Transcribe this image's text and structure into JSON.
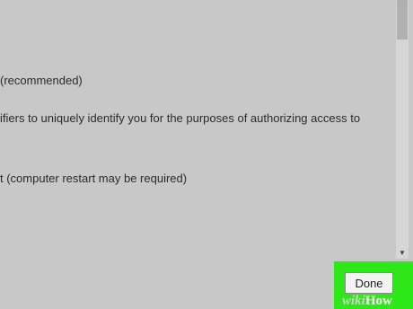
{
  "settings": {
    "lines": [
      "(recommended)",
      "ifiers to uniquely identify you for the purposes of authorizing access to",
      "t (computer restart may be required)"
    ]
  },
  "footer": {
    "done_label": "Done",
    "highlight_color": "#2fe81a"
  },
  "watermark": {
    "part1": "wiki",
    "part2": "How"
  }
}
